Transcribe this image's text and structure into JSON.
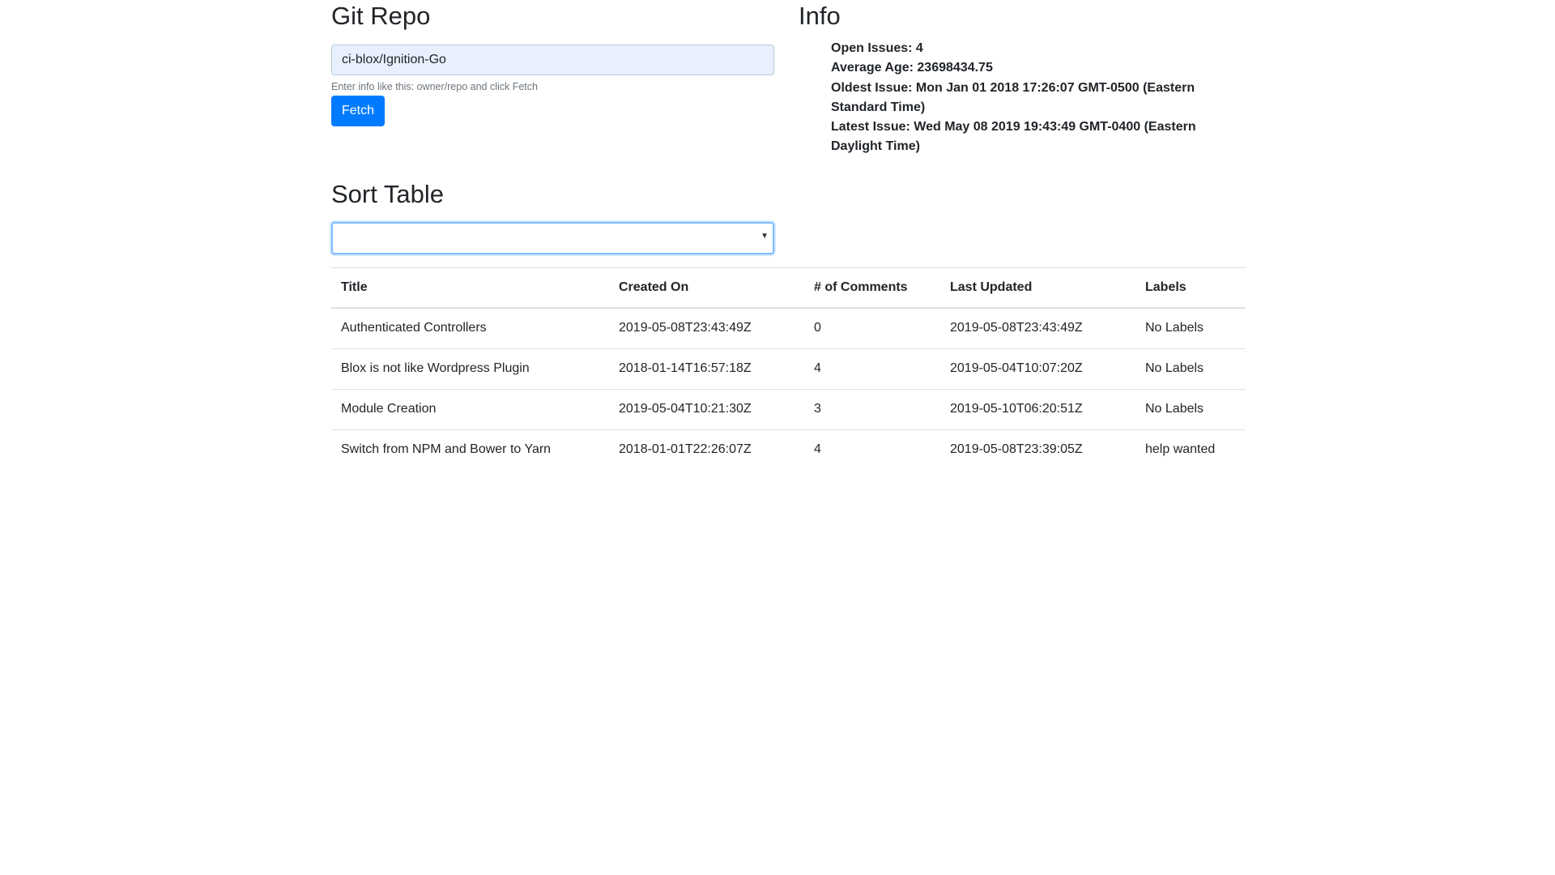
{
  "repo": {
    "heading": "Git Repo",
    "input_value": "ci-blox/Ignition-Go",
    "help_text": "Enter info like this: owner/repo and click Fetch",
    "fetch_label": "Fetch"
  },
  "info": {
    "heading": "Info",
    "items": [
      "Open Issues: 4",
      "Average Age: 23698434.75",
      "Oldest Issue: Mon Jan 01 2018 17:26:07 GMT-0500 (Eastern Standard Time)",
      "Latest Issue: Wed May 08 2019 19:43:49 GMT-0400 (Eastern Daylight Time)"
    ]
  },
  "sort": {
    "heading": "Sort Table",
    "selected_value": ""
  },
  "table": {
    "columns": [
      "Title",
      "Created On",
      "# of Comments",
      "Last Updated",
      "Labels"
    ],
    "rows": [
      [
        "Authenticated Controllers",
        "2019-05-08T23:43:49Z",
        "0",
        "2019-05-08T23:43:49Z",
        "No Labels"
      ],
      [
        "Blox is not like Wordpress Plugin",
        "2018-01-14T16:57:18Z",
        "4",
        "2019-05-04T10:07:20Z",
        "No Labels"
      ],
      [
        "Module Creation",
        "2019-05-04T10:21:30Z",
        "3",
        "2019-05-10T06:20:51Z",
        "No Labels"
      ],
      [
        "Switch from NPM and Bower to Yarn",
        "2018-01-01T22:26:07Z",
        "4",
        "2019-05-08T23:39:05Z",
        "help wanted"
      ]
    ]
  },
  "colors": {
    "primary": "#007bff",
    "autofill_bg": "#e8f0fe",
    "focus_border": "#80bdff",
    "border": "#dee2e6"
  }
}
